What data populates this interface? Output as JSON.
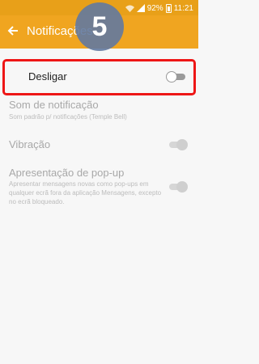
{
  "status_bar": {
    "battery": "92%",
    "time": "11:21"
  },
  "header": {
    "title": "Notificações",
    "back_icon": "arrow-left-icon"
  },
  "step_badge": "5",
  "settings": {
    "off": {
      "label": "Desligar",
      "enabled": false
    },
    "sound": {
      "title": "Som de notificação",
      "subtitle": "Som padrão p/ notificações (Temple Bell)"
    },
    "vibration": {
      "title": "Vibração",
      "enabled": true
    },
    "popup": {
      "title": "Apresentação de pop-up",
      "description": "Apresentar mensagens novas como pop-ups em qualquer ecrã fora da aplicação Mensagens, excepto no ecrã bloqueado.",
      "enabled": true
    }
  },
  "colors": {
    "app_bar": "#f0a520",
    "highlight_border": "#ee1616",
    "badge": "#6279a0"
  }
}
